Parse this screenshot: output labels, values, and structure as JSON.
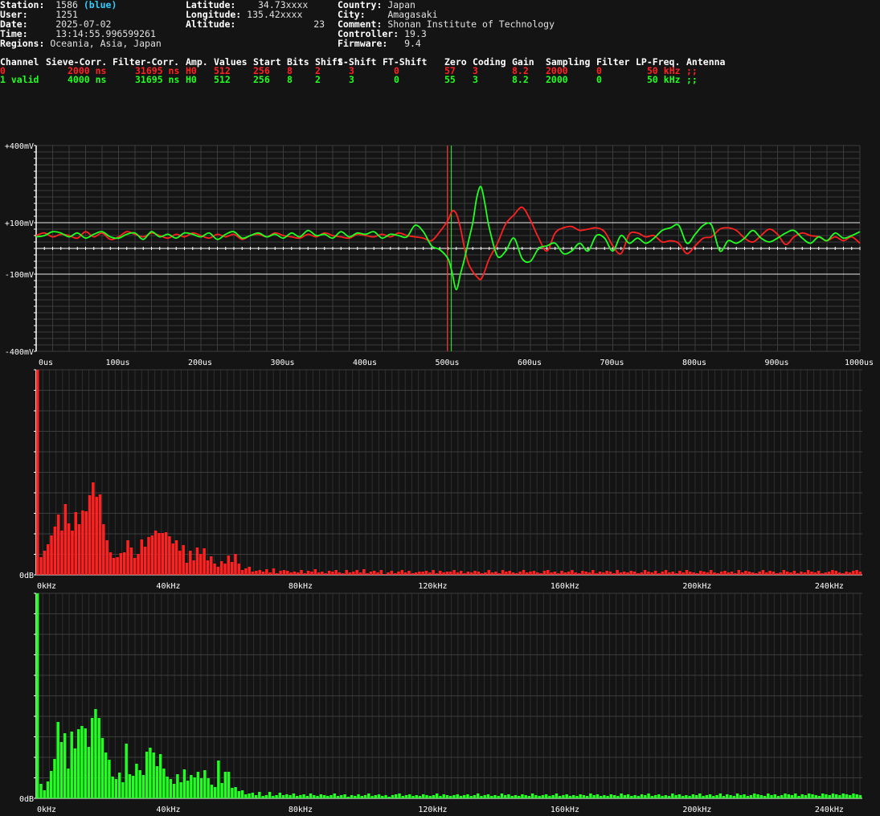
{
  "station": {
    "col1": [
      {
        "k": "Station:",
        "v": "1586",
        "extra": "(blue)"
      },
      {
        "k": "User:",
        "v": "1251"
      },
      {
        "k": "Date:",
        "v": "2025-07-02"
      },
      {
        "k": "Time:",
        "v": "13:14:55.996599261"
      },
      {
        "k": "Regions:",
        "v": "Oceania, Asia, Japan"
      }
    ],
    "col2": [
      {
        "k": "Latitude:",
        "v": "34.73xxxx"
      },
      {
        "k": "Longitude:",
        "v": "135.42xxxx"
      },
      {
        "k": "Altitude:",
        "v": "23"
      }
    ],
    "col3": [
      {
        "k": "Country:",
        "v": "Japan"
      },
      {
        "k": "City:",
        "v": "Amagasaki"
      },
      {
        "k": "Comment:",
        "v": "Shonan Institute of Technology"
      },
      {
        "k": "Controller:",
        "v": "19.3"
      },
      {
        "k": "Firmware:",
        "v": "9.4"
      }
    ]
  },
  "table": {
    "headers": [
      "Channel",
      "Sieve-Corr.",
      "Filter-Corr.",
      "Amp.",
      "Values",
      "Start",
      "Bits",
      "Shift",
      "S-Shift",
      "FT-Shift",
      "Zero",
      "Coding",
      "Gain",
      "Sampling",
      "Filter",
      "LP-Freq.",
      "Antenna"
    ],
    "rows": [
      [
        "0",
        "2000 ns",
        "31695 ns",
        "H0",
        "512",
        "256",
        "8",
        "2",
        "3",
        "0",
        "57",
        "3",
        "8.2",
        "2000",
        "0",
        "50 kHz",
        ";;"
      ],
      [
        "1 valid",
        "4000 ns",
        "31695 ns",
        "H0",
        "512",
        "256",
        "8",
        "2",
        "3",
        "0",
        "55",
        "3",
        "8.2",
        "2000",
        "0",
        "50 kHz",
        ";;"
      ]
    ]
  },
  "colors": {
    "ch0": "#ff2020",
    "ch1": "#20ff20",
    "grid": "#3c3c3c",
    "axis": "#ffffff",
    "bg": "#141414"
  },
  "chart_data": [
    {
      "type": "line",
      "title": "",
      "xlabel": "",
      "ylabel": "",
      "xlim": [
        0,
        1000
      ],
      "ylim": [
        -400,
        400
      ],
      "xticks": [
        "0us",
        "100us",
        "200us",
        "300us",
        "400us",
        "500us",
        "600us",
        "700us",
        "800us",
        "900us",
        "1000us"
      ],
      "yticks": [
        "+400mV",
        "+100mV",
        "-100mV",
        "-400mV"
      ],
      "markers_us": [
        500,
        505
      ],
      "series": [
        {
          "channel": "0",
          "x": [
            0,
            10,
            20,
            30,
            40,
            50,
            60,
            70,
            80,
            90,
            100,
            110,
            120,
            130,
            140,
            150,
            160,
            170,
            180,
            190,
            200,
            210,
            220,
            230,
            240,
            250,
            260,
            270,
            280,
            290,
            300,
            310,
            320,
            330,
            340,
            350,
            360,
            370,
            380,
            390,
            400,
            410,
            420,
            430,
            440,
            450,
            460,
            470,
            480,
            490,
            500,
            505,
            510,
            515,
            520,
            525,
            530,
            535,
            540,
            545,
            550,
            560,
            570,
            580,
            590,
            600,
            610,
            620,
            630,
            640,
            650,
            660,
            670,
            680,
            690,
            700,
            710,
            720,
            730,
            740,
            750,
            760,
            770,
            780,
            790,
            800,
            810,
            820,
            830,
            840,
            850,
            860,
            870,
            880,
            890,
            900,
            910,
            920,
            930,
            940,
            950,
            960,
            970,
            980,
            990,
            1000
          ],
          "y": [
            50,
            60,
            45,
            55,
            50,
            40,
            65,
            45,
            60,
            35,
            45,
            65,
            55,
            45,
            60,
            50,
            40,
            55,
            45,
            60,
            50,
            40,
            55,
            45,
            55,
            35,
            50,
            55,
            45,
            60,
            50,
            45,
            40,
            55,
            45,
            60,
            50,
            45,
            40,
            55,
            50,
            45,
            55,
            45,
            60,
            50,
            45,
            40,
            30,
            65,
            110,
            145,
            135,
            80,
            0,
            -60,
            -90,
            -110,
            -120,
            -85,
            -40,
            20,
            95,
            130,
            160,
            110,
            40,
            -10,
            60,
            80,
            85,
            70,
            75,
            80,
            65,
            10,
            -20,
            55,
            60,
            45,
            50,
            25,
            30,
            20,
            -20,
            10,
            40,
            45,
            75,
            80,
            70,
            40,
            25,
            50,
            75,
            55,
            15,
            45,
            60,
            50,
            45,
            30,
            45,
            30,
            45,
            20
          ]
        },
        {
          "channel": "1",
          "x": [
            0,
            10,
            20,
            30,
            40,
            50,
            60,
            70,
            80,
            90,
            100,
            110,
            120,
            130,
            140,
            150,
            160,
            170,
            180,
            190,
            200,
            210,
            220,
            230,
            240,
            250,
            260,
            270,
            280,
            290,
            300,
            310,
            320,
            330,
            340,
            350,
            360,
            370,
            380,
            390,
            400,
            410,
            420,
            430,
            440,
            450,
            460,
            470,
            480,
            490,
            500,
            505,
            510,
            515,
            520,
            525,
            530,
            535,
            540,
            545,
            550,
            560,
            570,
            580,
            590,
            600,
            610,
            620,
            630,
            640,
            650,
            660,
            670,
            680,
            690,
            700,
            710,
            720,
            730,
            740,
            750,
            760,
            770,
            780,
            790,
            800,
            810,
            820,
            830,
            840,
            850,
            860,
            870,
            880,
            890,
            900,
            910,
            920,
            930,
            940,
            950,
            960,
            970,
            980,
            990,
            1000
          ],
          "y": [
            45,
            50,
            65,
            60,
            45,
            60,
            40,
            55,
            65,
            45,
            40,
            55,
            60,
            35,
            65,
            45,
            55,
            40,
            60,
            55,
            45,
            60,
            35,
            55,
            65,
            40,
            50,
            60,
            45,
            55,
            40,
            60,
            45,
            70,
            50,
            55,
            40,
            65,
            45,
            60,
            55,
            65,
            40,
            55,
            50,
            45,
            90,
            65,
            10,
            -5,
            -40,
            -95,
            -160,
            -100,
            -40,
            30,
            100,
            200,
            240,
            170,
            80,
            -30,
            -10,
            40,
            -40,
            -50,
            0,
            10,
            20,
            -20,
            -10,
            20,
            -10,
            50,
            40,
            -10,
            50,
            20,
            40,
            20,
            40,
            70,
            80,
            90,
            20,
            55,
            90,
            90,
            -10,
            30,
            20,
            40,
            70,
            40,
            25,
            40,
            60,
            70,
            40,
            20,
            45,
            30,
            60,
            40,
            50,
            65
          ]
        }
      ]
    },
    {
      "type": "bar",
      "channel": "0",
      "xlim": [
        0,
        250
      ],
      "xticks": [
        "0kHz",
        "40kHz",
        "80kHz",
        "120kHz",
        "160kHz",
        "200kHz",
        "240kHz"
      ],
      "yticks": [
        "0dB"
      ],
      "values": [
        255,
        22,
        30,
        38,
        49,
        60,
        75,
        55,
        88,
        64,
        55,
        78,
        63,
        80,
        79,
        99,
        115,
        97,
        100,
        63,
        43,
        28,
        21,
        22,
        27,
        28,
        43,
        34,
        21,
        26,
        44,
        35,
        47,
        49,
        55,
        52,
        52,
        53,
        48,
        39,
        43,
        30,
        37,
        15,
        30,
        18,
        34,
        26,
        33,
        18,
        23,
        14,
        10,
        17,
        14,
        24,
        16,
        26,
        14,
        6,
        8,
        10,
        4,
        5,
        6,
        4,
        7,
        3,
        8,
        2,
        5,
        6,
        5,
        3,
        4,
        3,
        6,
        2,
        5,
        4,
        7,
        3,
        4,
        2,
        5,
        4,
        6,
        3,
        2,
        6,
        3,
        4,
        6,
        3,
        7,
        2,
        4,
        5,
        3,
        6,
        1,
        3,
        5,
        2,
        4,
        6,
        3,
        5,
        2,
        3,
        4,
        4,
        5,
        3,
        6,
        2,
        5,
        3,
        4,
        4,
        6,
        3,
        5,
        2,
        4,
        3,
        5,
        4,
        2,
        3,
        6,
        3,
        4,
        2,
        6,
        4,
        5,
        3,
        2,
        4,
        6,
        3,
        4,
        5,
        3,
        2,
        5,
        6,
        3,
        4,
        2,
        5,
        3,
        4,
        6,
        3,
        2,
        5,
        4,
        3,
        6,
        2,
        4,
        3,
        5,
        4,
        2,
        6,
        3,
        4,
        3,
        5,
        4,
        2,
        3,
        6,
        4,
        3,
        5,
        2,
        4,
        6,
        3,
        4,
        2,
        5,
        3,
        6,
        4,
        3,
        2,
        5,
        4,
        3,
        6,
        3,
        2,
        4,
        5,
        3,
        4,
        2,
        6,
        3,
        5,
        4,
        3,
        2,
        4,
        6,
        3,
        5,
        4,
        2,
        3,
        6,
        4,
        3,
        5,
        2,
        4,
        3,
        6,
        4,
        3,
        5,
        2,
        3,
        4,
        6,
        5,
        3,
        2,
        4,
        3,
        5,
        6,
        4
      ]
    },
    {
      "type": "bar",
      "channel": "1",
      "xlim": [
        0,
        250
      ],
      "xticks": [
        "0kHz",
        "40kHz",
        "80kHz",
        "120kHz",
        "160kHz",
        "200kHz",
        "240kHz"
      ],
      "yticks": [
        "0dB"
      ],
      "values": [
        255,
        18,
        10,
        21,
        34,
        49,
        95,
        70,
        81,
        37,
        83,
        62,
        86,
        90,
        87,
        64,
        100,
        111,
        100,
        75,
        57,
        48,
        27,
        24,
        32,
        20,
        68,
        30,
        28,
        43,
        35,
        29,
        58,
        63,
        57,
        40,
        55,
        37,
        27,
        24,
        18,
        30,
        20,
        36,
        22,
        29,
        26,
        33,
        25,
        35,
        25,
        17,
        14,
        47,
        19,
        33,
        33,
        13,
        14,
        9,
        10,
        5,
        6,
        7,
        4,
        8,
        3,
        4,
        8,
        3,
        4,
        7,
        4,
        5,
        4,
        6,
        3,
        4,
        5,
        3,
        6,
        4,
        3,
        5,
        4,
        3,
        4,
        6,
        3,
        4,
        5,
        2,
        4,
        3,
        5,
        3,
        4,
        6,
        3,
        4,
        5,
        3,
        4,
        2,
        4,
        5,
        6,
        3,
        4,
        5,
        3,
        4,
        3,
        5,
        4,
        3,
        4,
        6,
        3,
        5,
        4,
        3,
        4,
        5,
        3,
        4,
        5,
        3,
        4,
        6,
        3,
        4,
        5,
        3,
        4,
        3,
        6,
        4,
        5,
        3,
        4,
        3,
        5,
        4,
        3,
        6,
        4,
        3,
        4,
        5,
        3,
        4,
        6,
        3,
        4,
        5,
        3,
        4,
        3,
        5,
        4,
        3,
        6,
        4,
        5,
        3,
        4,
        3,
        5,
        4,
        3,
        6,
        4,
        5,
        3,
        4,
        3,
        5,
        4,
        6,
        3,
        4,
        5,
        3,
        4,
        3,
        6,
        4,
        5,
        3,
        4,
        3,
        5,
        4,
        6,
        3,
        4,
        5,
        3,
        4,
        6,
        3,
        5,
        4,
        3,
        6,
        4,
        5,
        3,
        4,
        6,
        5,
        4,
        3,
        6,
        4,
        5,
        3,
        4,
        6,
        5,
        4,
        6,
        3,
        5,
        4,
        6,
        5,
        4,
        3,
        6,
        5,
        4,
        6,
        5,
        4,
        6,
        5,
        4,
        6,
        5,
        4
      ]
    }
  ]
}
